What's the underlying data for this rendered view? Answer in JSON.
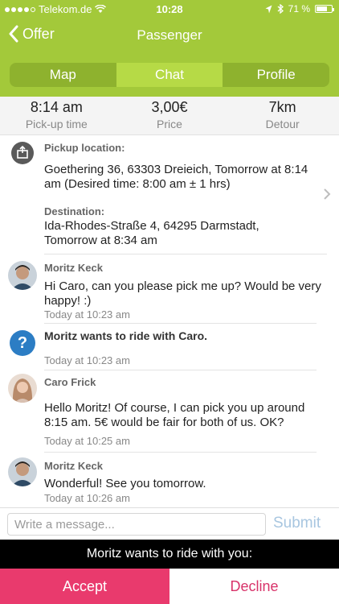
{
  "statusbar": {
    "carrier": "Telekom.de",
    "time": "10:28",
    "battery": "71 %",
    "battery_level": 0.71
  },
  "nav": {
    "back_label": "Offer",
    "title": "Passenger"
  },
  "tabs": [
    {
      "label": "Map"
    },
    {
      "label": "Chat",
      "active": true
    },
    {
      "label": "Profile"
    }
  ],
  "summary": [
    {
      "value": "8:14 am",
      "label": "Pick-up time"
    },
    {
      "value": "3,00€",
      "label": "Price"
    },
    {
      "value": "7km",
      "label": "Detour"
    }
  ],
  "trip": {
    "pickup_label": "Pickup location:",
    "pickup_text": "Goethering 36,  63303 Dreieich, Tomorrow at 8:14 am (Desired time: 8:00 am ± 1 hrs)",
    "destination_label": "Destination:",
    "destination_text": "Ida-Rhodes-Straße 4,  64295 Darmstadt, Tomorrow at 8:34 am"
  },
  "messages": [
    {
      "name": "Moritz Keck",
      "text": "Hi Caro, can you please pick me up? Would be very happy! :)",
      "time": "Today at 10:23 am"
    },
    {
      "text": "Moritz wants to ride with Caro.",
      "time": "Today at 10:23 am"
    },
    {
      "name": "Caro Frick",
      "text": "Hello Moritz! Of course, I can pick you up around 8:15 am. 5€ would be fair for both of us. OK?",
      "time": "Today at 10:25 am"
    },
    {
      "name": "Moritz Keck",
      "text": "Wonderful! See you tomorrow.",
      "time": "Today at 10:26 am"
    }
  ],
  "composer": {
    "placeholder": "Write a message...",
    "submit_label": "Submit"
  },
  "request": {
    "text": "Moritz wants to ride with you:",
    "accept_label": "Accept",
    "decline_label": "Decline"
  },
  "colors": {
    "header": "#a3c93a",
    "accept": "#e93a6d",
    "decline_text": "#d8336a",
    "info_icon": "#2c7dc4"
  },
  "icons": [
    "chevron-left-icon",
    "location-icon",
    "question-icon",
    "chevron-right-icon",
    "wifi-icon",
    "bluetooth-icon",
    "battery-icon"
  ]
}
